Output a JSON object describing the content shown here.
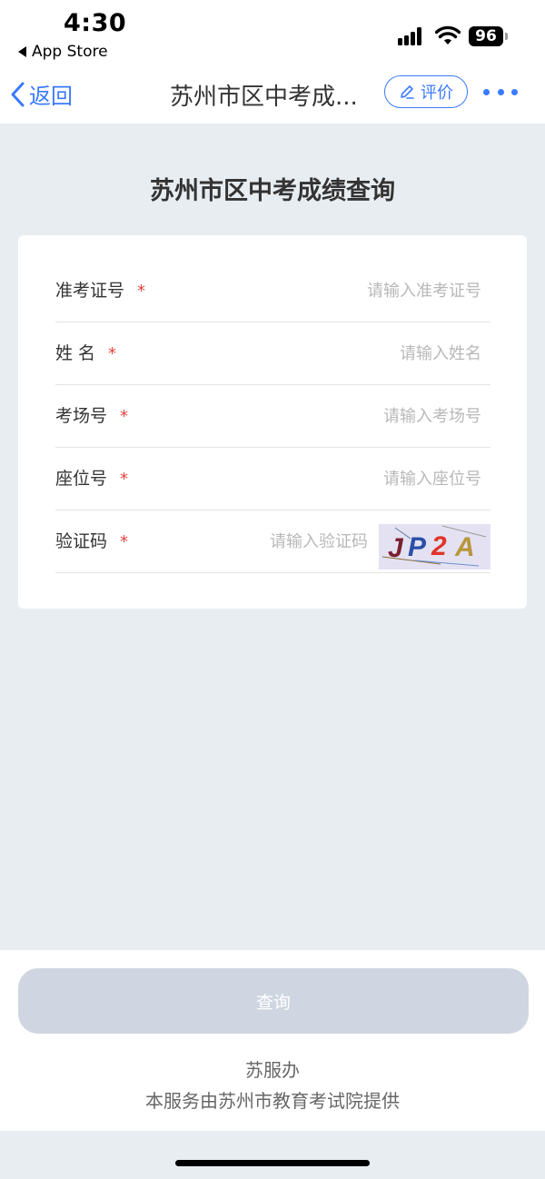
{
  "status_bar": {
    "time": "4:30",
    "back_app": "App Store",
    "battery": "96"
  },
  "nav": {
    "back_label": "返回",
    "title": "苏州市区中考成...",
    "rate_label": "评价"
  },
  "page": {
    "title": "苏州市区中考成绩查询"
  },
  "form": {
    "required_mark": "*",
    "fields": [
      {
        "label": "准考证号",
        "placeholder": "请输入准考证号"
      },
      {
        "label": "姓 名",
        "placeholder": "请输入姓名"
      },
      {
        "label": "考场号",
        "placeholder": "请输入考场号"
      },
      {
        "label": "座位号",
        "placeholder": "请输入座位号"
      },
      {
        "label": "验证码",
        "placeholder": "请输入验证码"
      }
    ],
    "captcha_text": "JP2A"
  },
  "footer": {
    "query_label": "查询",
    "brand": "苏服办",
    "provider": "本服务由苏州市教育考试院提供"
  },
  "colors": {
    "accent": "#3a7afe",
    "required": "#e0443e",
    "background": "#e8edf1",
    "button_disabled": "#cfd6e1"
  },
  "icons": [
    "signal-icon",
    "wifi-icon",
    "chevron-left-icon",
    "edit-icon",
    "more-icon"
  ]
}
